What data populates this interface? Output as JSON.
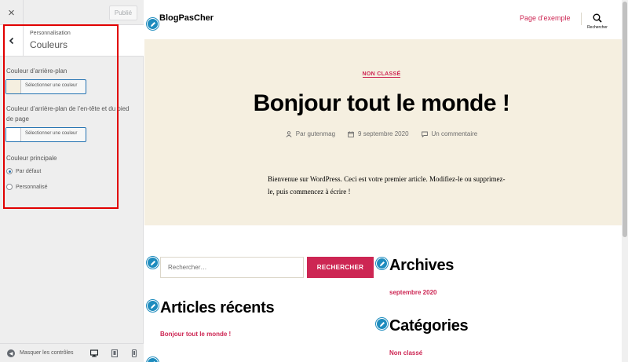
{
  "customizer": {
    "close_label": "×",
    "publish_label": "Publié",
    "breadcrumb": "Personnalisation",
    "section_title": "Couleurs",
    "controls": {
      "background_label": "Couleur d’arrière-plan",
      "background_button": "Sélectionner une couleur",
      "header_footer_label": "Couleur d’arrière-plan de l’en-tête et du pied de page",
      "header_footer_button": "Sélectionner une couleur",
      "primary_label": "Couleur principale",
      "primary_options": [
        "Par défaut",
        "Personnalisé"
      ],
      "primary_selected": "Par défaut"
    },
    "footer": {
      "collapse_label": "Masquer les contrôles",
      "devices": [
        "desktop-icon",
        "tablet-icon",
        "mobile-icon"
      ]
    }
  },
  "site": {
    "title": "BlogPasCher",
    "nav_link": "Page d’exemple",
    "search_toggle_label": "Rechercher"
  },
  "post": {
    "category": "NON CLASSÉ",
    "title": "Bonjour tout le monde !",
    "author": "Par gutenmag",
    "date": "9 septembre 2020",
    "comments": "Un commentaire",
    "body": "Bienvenue sur WordPress. Ceci est votre premier article. Modifiez-le ou supprimez-le, puis commencez à écrire !"
  },
  "widgets": {
    "search_placeholder": "Rechercher…",
    "search_button": "RECHERCHER",
    "archives_title": "Archives",
    "archives_item": "septembre 2020",
    "recent_title": "Articles récents",
    "recent_item": "Bonjour tout le monde !",
    "categories_title": "Catégories",
    "categories_item": "Non classé"
  },
  "colors": {
    "accent": "#cd2653",
    "hero_background": "#f5efe0",
    "edit_shortcut": "#1e8cbe",
    "highlight": "#e10000"
  }
}
